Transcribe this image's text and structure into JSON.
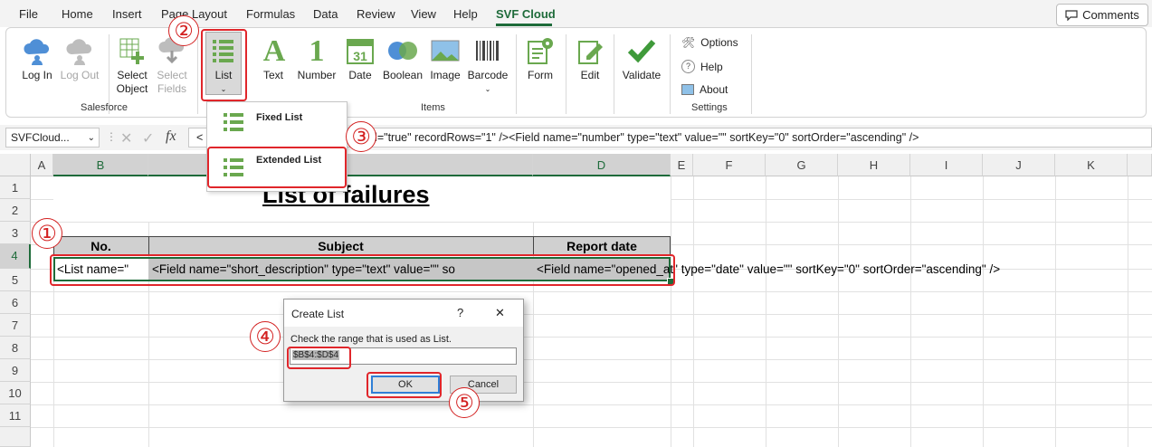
{
  "menu": {
    "tabs": [
      "File",
      "Home",
      "Insert",
      "Page Layout",
      "Formulas",
      "Data",
      "Review",
      "View",
      "Help",
      "SVF Cloud"
    ],
    "comments_label": "Comments"
  },
  "ribbon": {
    "salesforce_group": {
      "label": "Salesforce",
      "log_in": "Log In",
      "log_out": "Log Out",
      "select_object_1": "Select",
      "select_object_2": "Object",
      "select_fields_1": "Select",
      "select_fields_2": "Fields"
    },
    "items_group": {
      "label": "Items",
      "list": "List",
      "text": "Text",
      "number": "Number",
      "date": "Date",
      "boolean": "Boolean",
      "image": "Image",
      "barcode": "Barcode",
      "date_icon_text": "31"
    },
    "form": "Form",
    "edit": "Edit",
    "validate": "Validate",
    "settings_group": {
      "label": "Settings",
      "options": "Options",
      "help": "Help",
      "about": "About"
    }
  },
  "list_dropdown": {
    "fixed_list": "Fixed List",
    "extended_list": "Extended List"
  },
  "formula_bar": {
    "name_box": "SVFCloud...",
    "fx": "fx",
    "formula_start": "<",
    "formula_value": "extend=\"true\" recordRows=\"1\" /><Field name=\"number\" type=\"text\" value=\"\" sortKey=\"0\" sortOrder=\"ascending\" />"
  },
  "sheet": {
    "columns": [
      "A",
      "B",
      "C",
      "D",
      "E",
      "F",
      "G",
      "H",
      "I",
      "J",
      "K"
    ],
    "rows": [
      "1",
      "2",
      "3",
      "4",
      "5",
      "6",
      "7",
      "8",
      "9",
      "10",
      "11"
    ],
    "title": "List of failures",
    "header_no": "No.",
    "header_subject": "Subject",
    "header_report_date": "Report date",
    "b4": "<List name=\"",
    "c4": "<Field name=\"short_description\" type=\"text\" value=\"\" so",
    "d4": "<Field name=\"opened_at\" type=\"date\" value=\"\" sortKey=\"0\" sortOrder=\"ascending\" />"
  },
  "dialog": {
    "title": "Create List",
    "help_glyph": "?",
    "close_glyph": "✕",
    "prompt": "Check the range that is used as List.",
    "range_value": "$B$4:$D$4",
    "ok": "OK",
    "cancel": "Cancel"
  },
  "callouts": [
    "①",
    "②",
    "③",
    "④",
    "⑤"
  ],
  "colors": {
    "accent": "#1e6b3a",
    "callout_red": "#e0262b",
    "icon_green": "#6aa84f",
    "icon_blue": "#4f8fd6"
  }
}
